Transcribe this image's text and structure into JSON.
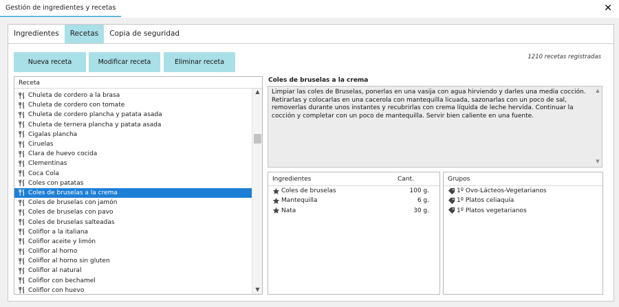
{
  "window": {
    "title": "Gestión de ingredientes y recetas",
    "close_glyph": "✕"
  },
  "tabs": [
    {
      "label": "Ingredientes",
      "active": false
    },
    {
      "label": "Recetas",
      "active": true
    },
    {
      "label": "Copia de seguridad",
      "active": false
    }
  ],
  "toolbar": {
    "new_label": "Nueva receta",
    "modify_label": "Modificar receta",
    "delete_label": "Eliminar receta",
    "count_text": "1210 recetas registradas"
  },
  "recipe_list": {
    "header": "Receta",
    "icon": "fork-knife-icon",
    "items": [
      "Chuleta de cordero a la brasa",
      "Chuleta de cordero con tomate",
      "Chuleta de cordero plancha y patata asada",
      "Chuleta de ternera plancha y patata asada",
      "Cigalas plancha",
      "Ciruelas",
      "Clara de huevo cocida",
      "Clementinas",
      "Coca Cola",
      "Coles con patatas",
      "Coles de bruselas a la crema",
      "Coles de bruselas con jamón",
      "Coles de bruselas con pavo",
      "Coles de bruselas salteadas",
      "Coliflor a la italiana",
      "Coliflor aceite y limón",
      "Coliflor al horno",
      "Coliflor al horno sin gluten",
      "Coliflor al natural",
      "Coliflor con bechamel",
      "Coliflor con huevo"
    ],
    "selected_index": 10
  },
  "detail": {
    "title": "Coles de bruselas a la crema",
    "description": "Limpiar las coles de Bruselas, ponerlas en una vasija con agua hirviendo y darles una media cocción. Retirarlas y colocarlas en una cacerola con mantequilla licuada, sazonarlas con un poco de sal, removerlas durante unos instantes y recubrirlas con crema líquida de leche hervida. Continuar la cocción y completar con un poco de mantequilla. Servir bien caliente en una fuente."
  },
  "ingredients": {
    "col_name": "Ingredientes",
    "col_qty": "Cant.",
    "icon": "star-icon",
    "rows": [
      {
        "name": "Coles de bruselas",
        "qty": "100 g."
      },
      {
        "name": "Mantequilla",
        "qty": "6 g."
      },
      {
        "name": "Nata",
        "qty": "30 g."
      }
    ]
  },
  "groups": {
    "header": "Grupos",
    "icon": "tag-icon",
    "rows": [
      "1º Ovo-Lácteos-Vegetarianos",
      "1º Platos celiaquía",
      "1º Platos vegetarianos"
    ]
  },
  "colors": {
    "accent": "#a9dfe7",
    "selection": "#1e7fd6",
    "title_underline": "#5fb6d8"
  }
}
